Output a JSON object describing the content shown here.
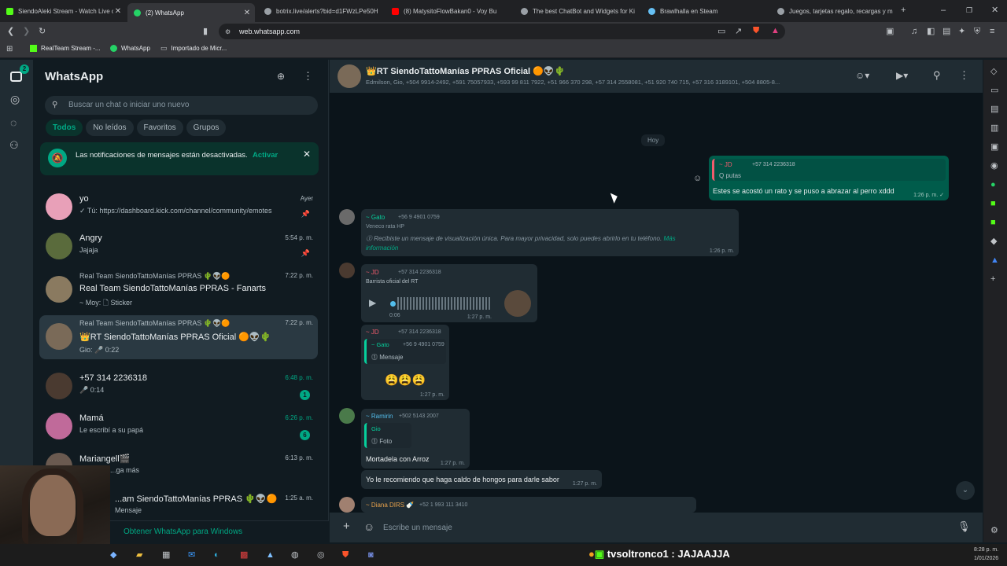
{
  "browser": {
    "tabs": [
      {
        "title": "SiendoAleki Stream - Watch Live on",
        "color": "#53fc18"
      },
      {
        "title": "(2) WhatsApp",
        "color": "#25d366"
      },
      {
        "title": "botrix.live/alerts?bid=d1FWzLPe50H",
        "color": "#9aa0a6"
      },
      {
        "title": "(8) MatysitoFlowBakan0 - Voy Bu",
        "color": "#ff0000"
      },
      {
        "title": "The best ChatBot and Widgets for Ki",
        "color": "#9aa0a6"
      },
      {
        "title": "Brawlhalla en Steam",
        "color": "#66c0f4"
      },
      {
        "title": "Juegos, tarjetas regalo, recargas y m",
        "color": "#9aa0a6"
      }
    ],
    "url": "web.whatsapp.com",
    "bookmarks": [
      "RealTeam Stream -...",
      "WhatsApp",
      "Importado de Micr..."
    ]
  },
  "rail": {
    "badge": "2"
  },
  "sidebar": {
    "title": "WhatsApp",
    "search_placeholder": "Buscar un chat o iniciar uno nuevo",
    "filters": [
      "Todos",
      "No leídos",
      "Favoritos",
      "Grupos"
    ],
    "notice": {
      "text": "Las notificaciones de mensajes están desactivadas.",
      "action": "Activar"
    },
    "chats": [
      {
        "group": "",
        "name": "yo",
        "msg": "✓ Tú: https://dashboard.kick.com/channel/community/emotes",
        "time": "Ayer",
        "avatar": "#e8a0b8"
      },
      {
        "group": "",
        "name": "Angry",
        "msg": "Jajaja",
        "time": "5:54 p. m.",
        "avatar": "#5a6b3c"
      },
      {
        "group": "Real Team SiendoTattoManías PPRAS 🌵👽🟠",
        "name": "Real Team SiendoTattoManías PPRAS - Fanarts",
        "msg": "~ Moy: 🗋 Sticker",
        "time": "7:22 p. m.",
        "avatar": "#8a7a60"
      },
      {
        "group": "Real Team SiendoTattoManías PPRAS 🌵👽🟠",
        "name": "👑RT SiendoTattoManías PPRAS Oficial 🟠👽🌵",
        "msg": "Gio: 🎤 0:22",
        "time": "7:22 p. m.",
        "avatar": "#7a6a58"
      },
      {
        "group": "",
        "name": "+57 314 2236318",
        "msg": "🎤 0:14",
        "time": "6:48 p. m.",
        "avatar": "#4a3a30",
        "badge": "1"
      },
      {
        "group": "",
        "name": "Mamá",
        "msg": "Le escribí a su papá",
        "time": "6:26 p. m.",
        "avatar": "#c06a9a",
        "badge": "6"
      },
      {
        "group": "",
        "name": "Mariangell🎬",
        "msg": "...ga más",
        "time": "6:13 p. m.",
        "avatar": "#6a5a50"
      },
      {
        "group": "",
        "name": "...am SiendoTattoManías PPRAS 🌵👽🟠",
        "msg": "Mensaje",
        "time": "1:25 a. m.",
        "avatar": "#7a6a58"
      }
    ],
    "download": "Obtener WhatsApp para Windows"
  },
  "chat": {
    "title": "👑RT SiendoTattoManías PPRAS Oficial 🟠👽🌵",
    "members": "Edmilson, Gio, +504 9914-2492, +591 75057933, +593 99 811 7922, +51 966 370 298, +57 314 2558081, +51 920 740 715, +57 316 3189101, +504 8805-8...",
    "day": "Hoy",
    "input_placeholder": "Escribe un mensaje",
    "messages": {
      "out1": {
        "sender": "~ JD",
        "phone": "+57 314 2236318",
        "quoted": "Q putas",
        "text": "Estes se acostó un rato y se puso a abrazar al perro xddd",
        "time": "1:26 p. m. ✓"
      },
      "m2": {
        "sender": "~ Gato",
        "phone": "+56 9 4901 0759",
        "sub": "Veneco rata HP",
        "text": "Recibiste un mensaje de visualización única. Para mayor privacidad, solo puedes abrirlo en tu teléfono.",
        "link": "Más información",
        "time": "1:26 p. m."
      },
      "m3": {
        "sender": "~ JD",
        "phone": "+57 314 2236318",
        "sub": "Barrista oficial del RT",
        "duration": "0:06",
        "time": "1:27 p. m."
      },
      "m4": {
        "sender": "~ JD",
        "phone": "+57 314 2236318",
        "q_sender": "~ Gato",
        "q_phone": "+56 9 4901 0759",
        "q_text": "Mensaje",
        "text": "😩😩😩",
        "time": "1:27 p. m."
      },
      "m5": {
        "sender": "~ Ramirin",
        "phone": "+502 5143 2007",
        "q_sender": "Gio",
        "q_text": "Foto",
        "text": "Mortadela con Arroz",
        "time": "1:27 p. m."
      },
      "m6": {
        "text": "Yo le recomiendo que haga caldo de hongos para darle sabor",
        "time": "1:27 p. m."
      },
      "m7": {
        "sender": "~ Diana DIRS 🍼",
        "phone": "+52 1 993 111 3410"
      }
    }
  },
  "overlay": {
    "text": "tvsoltronco1 : JAJAAJJA"
  },
  "taskbar": {
    "time": "8:28 p. m.",
    "date": "1/01/2026"
  }
}
